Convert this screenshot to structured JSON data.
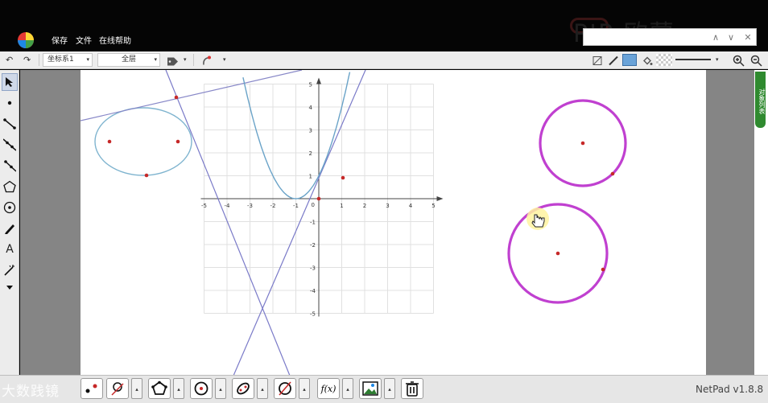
{
  "app": {
    "menu": [
      "保存",
      "文件",
      "在线帮助"
    ],
    "brand": "PIP 欧蒙",
    "version": "NetPad v1.8.8",
    "watermark": "大数践镜"
  },
  "find_bar": {
    "value": "",
    "up": "∧",
    "down": "∨",
    "close": "✕"
  },
  "toolbar": {
    "undo": "↶",
    "redo": "↷",
    "coord_system": "坐标系1",
    "layer": "全层",
    "caret": "▾"
  },
  "side_panel": {
    "label": "对象列表"
  },
  "left_tools": [
    "select",
    "point",
    "segment",
    "line",
    "ray",
    "polygon",
    "circle",
    "pen",
    "text",
    "magic",
    "more"
  ],
  "text_tool_label": "A",
  "colors": {
    "circle_stroke": "#c040d0",
    "ellipse_stroke": "#7fb4cf",
    "line_stroke": "#7a7ac8",
    "parabola_stroke": "#6aa3c8",
    "point": "#c62828",
    "grid": "#e0e0e0",
    "axis": "#444444"
  },
  "axes": {
    "x_ticks": [
      "-5",
      "-4",
      "-3",
      "-2",
      "-1",
      "1",
      "2",
      "3",
      "4",
      "5"
    ],
    "y_ticks_pos": [
      "5",
      "4",
      "3",
      "2",
      "1"
    ],
    "y_ticks_neg": [
      "-1",
      "-2",
      "-3",
      "-4",
      "-5"
    ],
    "origin": "0"
  },
  "bottom_tools": [
    "point-tool",
    "measure-tool",
    "polygon-tool",
    "circle-tool",
    "ellipse-tool",
    "construct-tool",
    "function-tool",
    "image-tool",
    "delete-tool"
  ],
  "function_label": "f(x)"
}
